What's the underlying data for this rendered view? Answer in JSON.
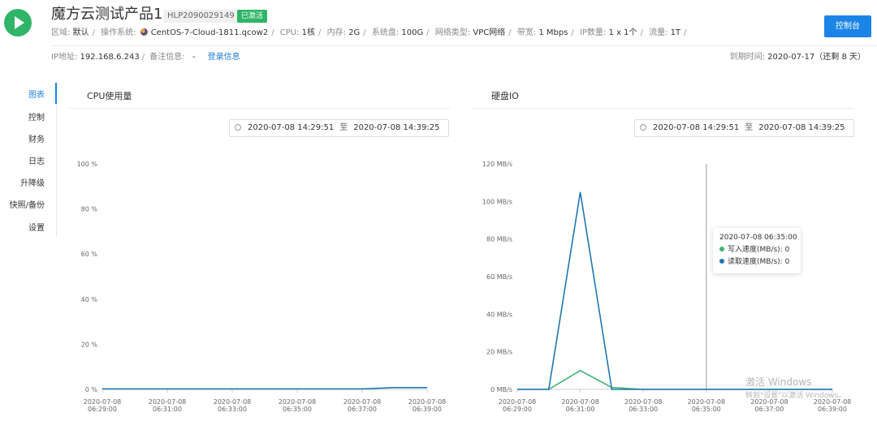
{
  "header": {
    "title": "魔方云测试产品1",
    "product_id": "HLP2090029149",
    "status": "已激活",
    "console_button": "控制台"
  },
  "specs": [
    {
      "label": "区域:",
      "value": "默认"
    },
    {
      "label": "操作系统:",
      "value": "CentOS-7-Cloud-1811.qcow2",
      "icon": "centos-icon"
    },
    {
      "label": "CPU:",
      "value": "1核"
    },
    {
      "label": "内存:",
      "value": "2G"
    },
    {
      "label": "系统盘:",
      "value": "100G"
    },
    {
      "label": "网络类型:",
      "value": "VPC网络"
    },
    {
      "label": "带宽:",
      "value": "1 Mbps"
    },
    {
      "label": "IP数量:",
      "value": "1 x 1个"
    },
    {
      "label": "流量:",
      "value": "1T"
    }
  ],
  "info": {
    "ip_label": "IP地址:",
    "ip": "192.168.6.243",
    "remark_label": "备注信息:",
    "remark": "-",
    "login_link": "登录信息",
    "expire_label": "到期时间:",
    "expire": "2020-07-17（还剩 8 天）"
  },
  "nav": [
    {
      "label": "图表",
      "active": true
    },
    {
      "label": "控制"
    },
    {
      "label": "财务"
    },
    {
      "label": "日志"
    },
    {
      "label": "升降级"
    },
    {
      "label": "快照/备份"
    },
    {
      "label": "设置"
    }
  ],
  "cpu_panel": {
    "title": "CPU使用量",
    "date_from": "2020-07-08 14:29:51",
    "date_sep": "至",
    "date_to": "2020-07-08 14:39:25"
  },
  "disk_panel": {
    "title": "硬盘IO",
    "date_from": "2020-07-08 14:29:51",
    "date_sep": "至",
    "date_to": "2020-07-08 14:39:25"
  },
  "chart_data": [
    {
      "type": "line",
      "title": "CPU使用量",
      "x": [
        "06:29",
        "06:30",
        "06:31",
        "06:32",
        "06:33",
        "06:34",
        "06:35",
        "06:36",
        "06:37",
        "06:38",
        "06:39"
      ],
      "x_tick_labels": [
        [
          "2020-07-08",
          "06:29:00"
        ],
        [
          "2020-07-08",
          "06:31:00"
        ],
        [
          "2020-07-08",
          "06:33:00"
        ],
        [
          "2020-07-08",
          "06:35:00"
        ],
        [
          "2020-07-08",
          "06:37:00"
        ],
        [
          "2020-07-08",
          "06:39:00"
        ]
      ],
      "y_ticks": [
        "0 %",
        "20 %",
        "40 %",
        "60 %",
        "80 %",
        "100 %"
      ],
      "ylim": [
        0,
        100
      ],
      "series": [
        {
          "values": [
            0.2,
            0.2,
            0.2,
            0.2,
            0.2,
            0.2,
            0.2,
            0.2,
            0.2,
            0.8,
            0.8
          ],
          "color": "#1f77b4"
        }
      ]
    },
    {
      "type": "line",
      "title": "硬盘IO",
      "x": [
        "06:29",
        "06:30",
        "06:31",
        "06:32",
        "06:33",
        "06:34",
        "06:35",
        "06:36",
        "06:37",
        "06:38",
        "06:39"
      ],
      "x_tick_labels": [
        [
          "2020-07-08",
          "06:29:00"
        ],
        [
          "2020-07-08",
          "06:31:00"
        ],
        [
          "2020-07-08",
          "06:33:00"
        ],
        [
          "2020-07-08",
          "06:35:00"
        ],
        [
          "2020-07-08",
          "06:37:00"
        ],
        [
          "2020-07-08",
          "06:39:00"
        ]
      ],
      "y_ticks": [
        "0 MB/s",
        "20 MB/s",
        "40 MB/s",
        "60 MB/s",
        "80 MB/s",
        "100 MB/s",
        "120 MB/s"
      ],
      "ylim": [
        0,
        120
      ],
      "series": [
        {
          "name": "写入速度(MB/s)",
          "values": [
            0,
            0,
            10,
            1,
            0,
            0,
            0,
            0,
            0,
            0,
            0
          ],
          "color": "#3cb371"
        },
        {
          "name": "读取速度(MB/s)",
          "values": [
            0,
            0,
            105,
            0,
            0,
            0,
            0,
            0,
            0,
            0,
            0
          ],
          "color": "#1f77b4"
        }
      ],
      "cursor_x": "06:35",
      "tooltip": {
        "time": "2020-07-08 06:35:00",
        "rows": [
          {
            "label": "写入速度(MB/s): 0",
            "color": "#3cb371"
          },
          {
            "label": "读取速度(MB/s): 0",
            "color": "#1f77b4"
          }
        ]
      }
    }
  ],
  "watermark": {
    "line1": "激活 Windows",
    "line2": "转到\"设置\"以激活 Windows。"
  }
}
